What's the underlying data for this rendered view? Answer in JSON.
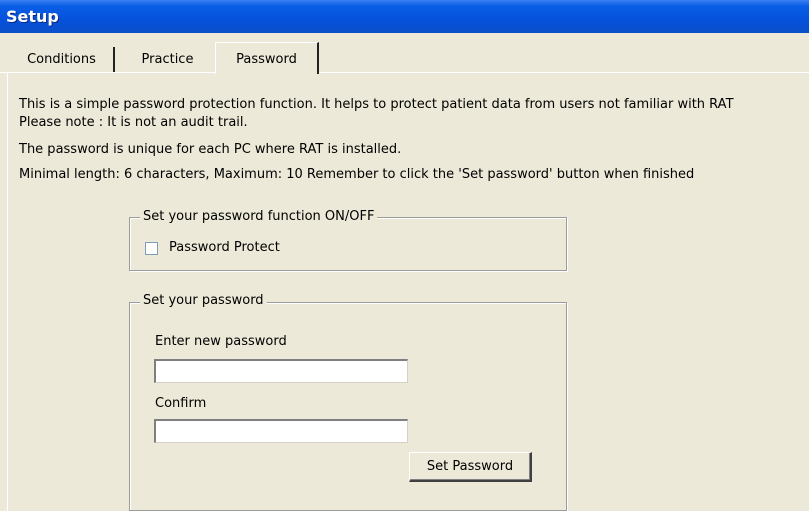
{
  "window": {
    "title": "Setup"
  },
  "tabs": [
    {
      "label": "Conditions",
      "selected": false
    },
    {
      "label": "Practice",
      "selected": false
    },
    {
      "label": "Password",
      "selected": true
    }
  ],
  "info": {
    "line1": "This is a simple password protection function. It helps to protect patient data from users not familiar with RAT",
    "line2": "Please note : It is not an audit trail.",
    "line3": "The password is unique for each PC where RAT is installed.",
    "line4": "Minimal length: 6 characters, Maximum: 10  Remember to click the 'Set password' button when finished"
  },
  "password_function": {
    "legend": "Set your password function  ON/OFF",
    "checkbox_label": "Password Protect",
    "checked": false
  },
  "set_password": {
    "legend": "Set your password",
    "new_label": "Enter new password",
    "new_value": "",
    "confirm_label": "Confirm",
    "confirm_value": "",
    "button_label": "Set Password"
  }
}
